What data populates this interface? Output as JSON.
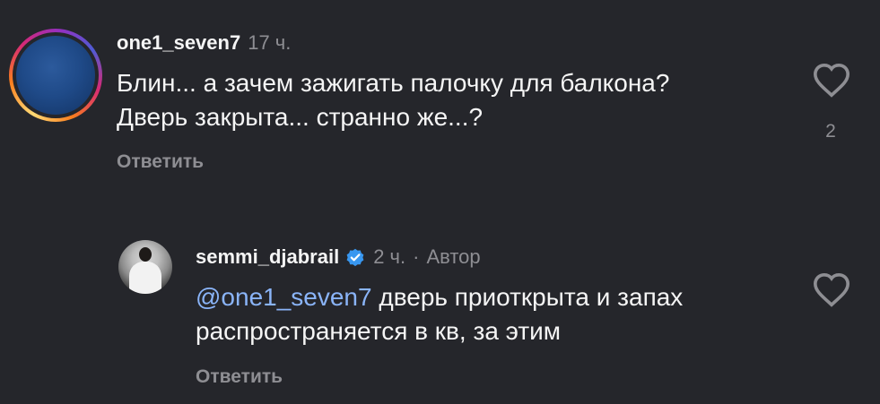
{
  "comments": [
    {
      "username": "one1_seven7",
      "time": "17 ч.",
      "text_line1": "Блин... а зачем зажигать палочку для балкона?",
      "text_line2": "Дверь закрыта... странно же...?",
      "reply_label": "Ответить",
      "like_count": "2"
    },
    {
      "username": "semmi_djabrail",
      "time": "2 ч.",
      "separator": "·",
      "author_badge": "Автор",
      "mention": "@one1_seven7",
      "text_line1_rest": " дверь приоткрыта и запах",
      "text_line2": "распространяется в кв, за этим",
      "reply_label": "Ответить"
    }
  ],
  "colors": {
    "background": "#25262b",
    "mention": "#8ab4f8",
    "verified": "#3897f0",
    "muted": "#8e8e93"
  },
  "icons": {
    "like": "heart-outline-icon",
    "verified": "verified-badge-icon"
  }
}
